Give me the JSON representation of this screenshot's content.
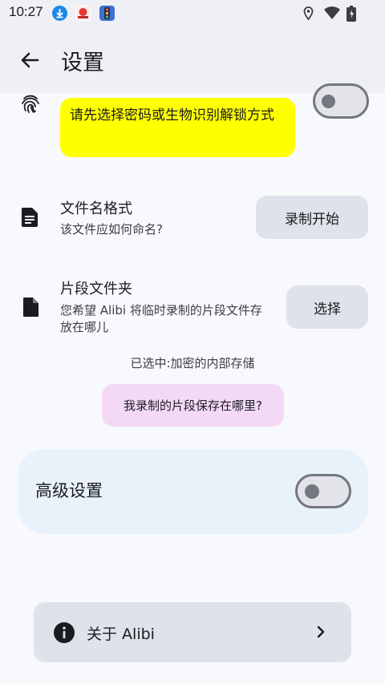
{
  "status_bar": {
    "time": "10:27",
    "notification_icons": [
      "download-icon",
      "app-badge-icon",
      "traffic-light-icon"
    ],
    "system_icons": [
      "location-icon",
      "wifi-icon",
      "battery-charging-icon"
    ]
  },
  "app_bar": {
    "back_icon": "arrow-left-icon",
    "title": "设置"
  },
  "biometric": {
    "icon": "fingerprint-icon",
    "tooltip": "请先选择密码或生物识别解锁方式",
    "toggle_on": false
  },
  "filename_format": {
    "icon": "document-icon",
    "title": "文件名格式",
    "subtitle": "该文件应如何命名?",
    "button_label": "录制开始"
  },
  "clip_folder": {
    "icon": "file-icon",
    "title": "片段文件夹",
    "subtitle": "您希望 Alibi 将临时录制的片段文件存放在哪儿",
    "button_label": "选择",
    "selected_text": "已选中:加密的内部存储",
    "help_pill": "我录制的片段保存在哪里?"
  },
  "advanced": {
    "label": "高级设置",
    "toggle_on": false
  },
  "about": {
    "icon": "info-icon",
    "label": "关于 Alibi",
    "chevron_icon": "chevron-right-icon"
  },
  "colors": {
    "background": "#f7f9fd",
    "tooltip_yellow": "#ffff00",
    "pill_purple": "#f4d9f7",
    "tonal_button": "#dfe2ea",
    "advanced_card": "#e9f2fb"
  }
}
